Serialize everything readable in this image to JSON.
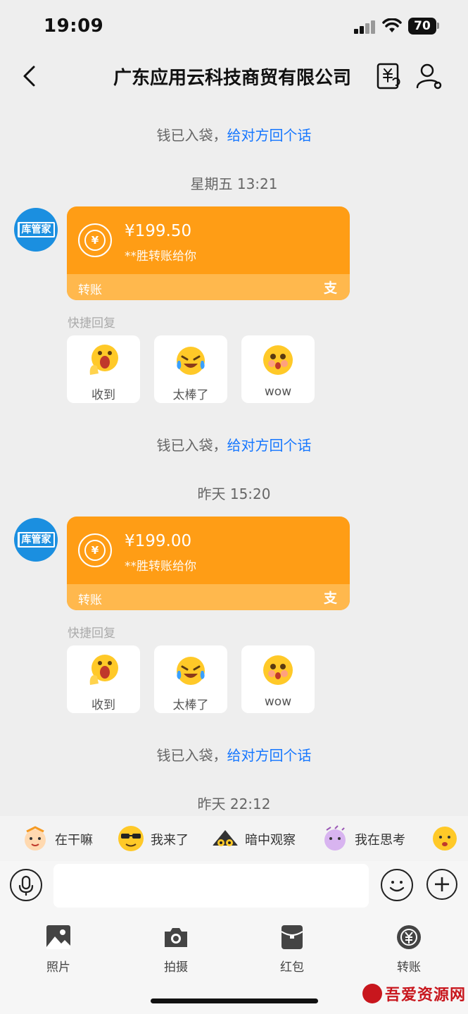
{
  "status": {
    "time": "19:09",
    "battery": "70"
  },
  "header": {
    "title": "广东应用云科技商贸有限公司"
  },
  "messages": {
    "received_prefix": "钱已入袋，",
    "reply_link": "给对方回个话",
    "ts1": "星期五 13:21",
    "ts2": "昨天 15:20",
    "ts3": "昨天 22:12",
    "avatar_text": "库管家",
    "card1": {
      "amount": "¥199.50",
      "subtitle": "**胜转账给你",
      "footer": "转账"
    },
    "card2": {
      "amount": "¥199.00",
      "subtitle": "**胜转账给你",
      "footer": "转账"
    },
    "quick_reply_title": "快捷回复",
    "quick_replies": [
      "收到",
      "太棒了",
      "wow"
    ]
  },
  "stickers": [
    "在干嘛",
    "我来了",
    "暗中观察",
    "我在思考"
  ],
  "toolbar": {
    "photo": "照片",
    "camera": "拍摄",
    "red_packet": "红包",
    "transfer": "转账"
  },
  "watermark": "吾爱资源网",
  "colors": {
    "card": "#ff9d15",
    "card_footer": "#ffb84d",
    "link": "#1677ff",
    "avatar": "#1b8fe0"
  }
}
